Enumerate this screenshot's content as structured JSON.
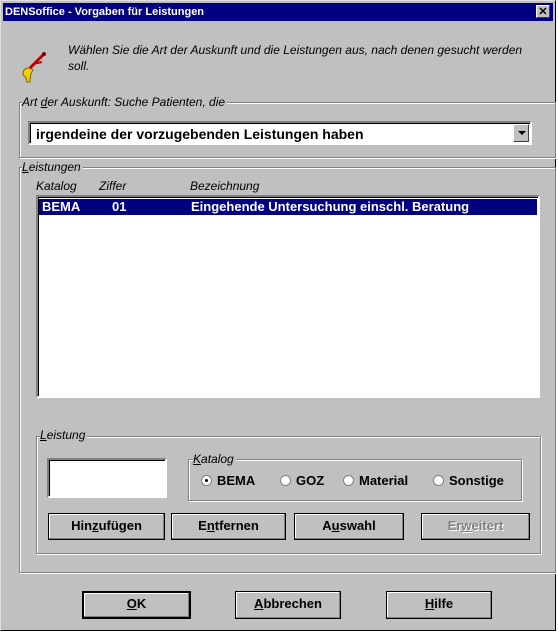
{
  "window": {
    "title": "DENSoffice - Vorgaben für Leistungen",
    "close": "✕"
  },
  "intro": {
    "icon": "tooth-tool-icon",
    "text": "Wählen Sie die Art der Auskunft und die Leistungen aus, nach denen gesucht werden soll."
  },
  "auskunft": {
    "legend_pre": "Art ",
    "legend_u": "d",
    "legend_post": "er Auskunft: Suche Patienten, die",
    "value": "irgendeine der vorzugebenden Leistungen haben"
  },
  "leistungen": {
    "legend_u": "L",
    "legend_post": "eistungen",
    "columns": [
      "Katalog",
      "Ziffer",
      "Bezeichnung"
    ],
    "rows": [
      {
        "katalog": "BEMA",
        "ziffer": "01",
        "bezeichnung": "Eingehende Untersuchung einschl. Beratung",
        "selected": true
      }
    ]
  },
  "leistung": {
    "legend_u": "L",
    "legend_post": "eistung",
    "input_value": "",
    "katalog_legend_u": "K",
    "katalog_legend_post": "atalog",
    "options": [
      "BEMA",
      "GOZ",
      "Material",
      "Sonstige"
    ],
    "selected_option": "BEMA",
    "buttons": {
      "add": {
        "pre": "Hin",
        "u": "z",
        "post": "ufügen"
      },
      "remove": {
        "pre": "E",
        "u": "n",
        "post": "tfernen"
      },
      "select": {
        "pre": "A",
        "u": "u",
        "post": "swahl"
      },
      "extended": {
        "pre": "Er",
        "u": "w",
        "post": "eitert"
      }
    }
  },
  "footer": {
    "ok": {
      "pre": "",
      "u": "O",
      "post": "K"
    },
    "cancel": {
      "pre": "",
      "u": "A",
      "post": "bbrechen"
    },
    "help": {
      "pre": "",
      "u": "H",
      "post": "ilfe"
    }
  }
}
